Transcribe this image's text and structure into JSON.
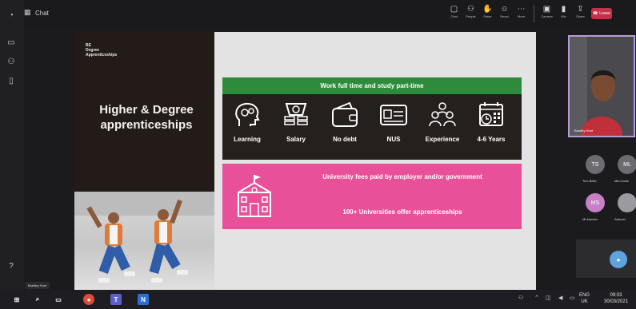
{
  "window": {
    "title": "Chat"
  },
  "toolbar": {
    "buttons": [
      {
        "icon": "chat-icon",
        "label": "Chat"
      },
      {
        "icon": "people-icon",
        "label": "People"
      },
      {
        "icon": "raise-hand-icon",
        "label": "Raise"
      },
      {
        "icon": "react-icon",
        "label": "React"
      },
      {
        "icon": "more-icon",
        "label": "More"
      },
      {
        "icon": "camera-icon",
        "label": "Camera"
      },
      {
        "icon": "mic-icon",
        "label": "Mic"
      },
      {
        "icon": "share-icon",
        "label": "Share"
      }
    ],
    "leave_label": "Leave"
  },
  "slide": {
    "logo": "BE\nDegree\nApprenticeships",
    "title": "Higher & Degree apprenticeships",
    "band_green": "Work full time and study part-time",
    "icons": [
      {
        "name": "learning-icon",
        "label": "Learning"
      },
      {
        "name": "salary-icon",
        "label": "Salary"
      },
      {
        "name": "no-debt-icon",
        "label": "No debt"
      },
      {
        "name": "nus-card-icon",
        "label": "NUS"
      },
      {
        "name": "experience-icon",
        "label": "Experience"
      },
      {
        "name": "calendar-icon",
        "label": "4-6 Years"
      }
    ],
    "pink_line1": "University fees paid by employer and/or government",
    "pink_line2": "100+ Universities offer apprenticeships"
  },
  "participants": {
    "self_name": "Bradley Hunt",
    "tiles": [
      {
        "initials": "TS",
        "name": "Tom Bello",
        "color": "#6b6b70"
      },
      {
        "initials": "ML",
        "name": "Mia Lewis",
        "color": "#6b6b70"
      },
      {
        "initials": "MS",
        "name": "Mi Ahmeto",
        "color": "#c77fc6"
      },
      {
        "initials": "",
        "name": "Samuel",
        "color": "#9a9aa0"
      }
    ]
  },
  "presenter_chip": "Bradley Hunt",
  "taskbar": {
    "apps": [
      {
        "icon": "windows-icon",
        "color": "#1e1e22",
        "text": "⊞"
      },
      {
        "icon": "search-icon",
        "color": "#1e1e22",
        "text": "⌕"
      },
      {
        "icon": "task-view-icon",
        "color": "#1e1e22",
        "text": "▭"
      },
      {
        "icon": "chrome-icon",
        "color": "#dd4b39",
        "text": "●"
      },
      {
        "icon": "teams-icon",
        "color": "#5b5fc7",
        "text": "T"
      },
      {
        "icon": "onenote-icon",
        "color": "#2b6ed8",
        "text": "N"
      }
    ],
    "date": "ENG\nUK",
    "time": "09:03\n30/03/2021"
  }
}
